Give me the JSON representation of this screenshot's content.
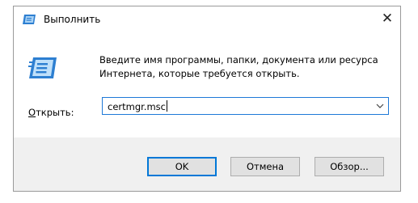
{
  "window": {
    "title": "Выполнить",
    "icon": "run-icon",
    "close_label": "✕"
  },
  "main": {
    "icon": "run-large-icon",
    "description": "Введите имя программы, папки, документа или ресурса Интернета, которые требуется открыть.",
    "open_label_underlined": "О",
    "open_label_rest": "ткрыть:",
    "input_value": "certmgr.msc"
  },
  "buttons": {
    "ok": "OK",
    "cancel": "Отмена",
    "browse": "Обзор..."
  },
  "colors": {
    "accent": "#0078d7",
    "footer_bg": "#f0f0f0"
  }
}
